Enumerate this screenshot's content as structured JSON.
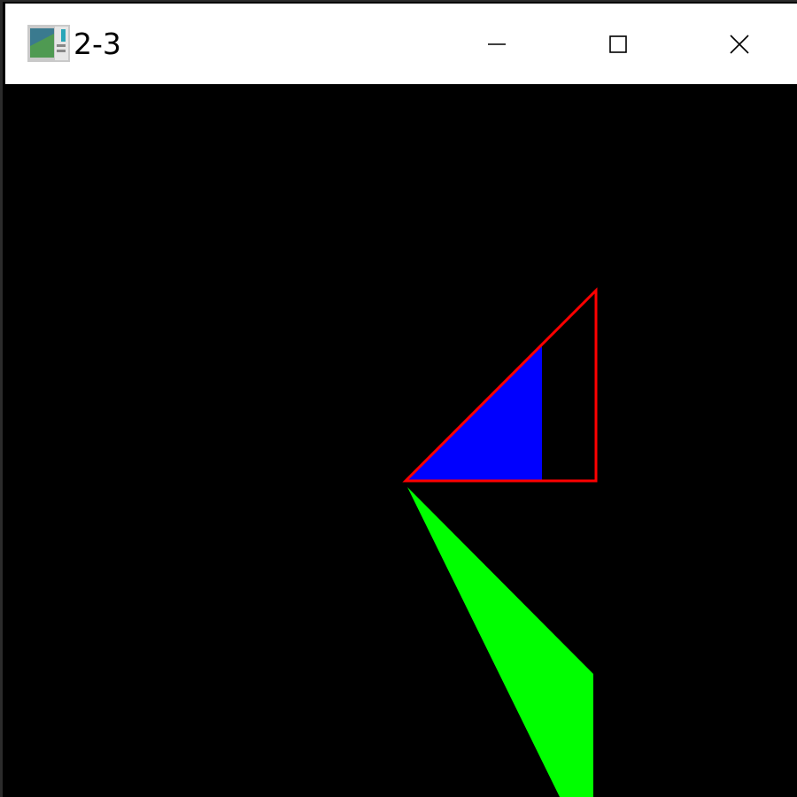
{
  "window": {
    "title": "2-3",
    "app_icon": "opengl-app-icon",
    "controls": {
      "minimize": "minimize-icon",
      "maximize": "maximize-icon",
      "close": "close-icon"
    }
  },
  "colors": {
    "titlebar_bg": "#ffffff",
    "canvas_bg": "#000000",
    "outline_triangle": "#ff0000",
    "blue_fill": "#0000ff",
    "green_fill": "#00ff00"
  }
}
